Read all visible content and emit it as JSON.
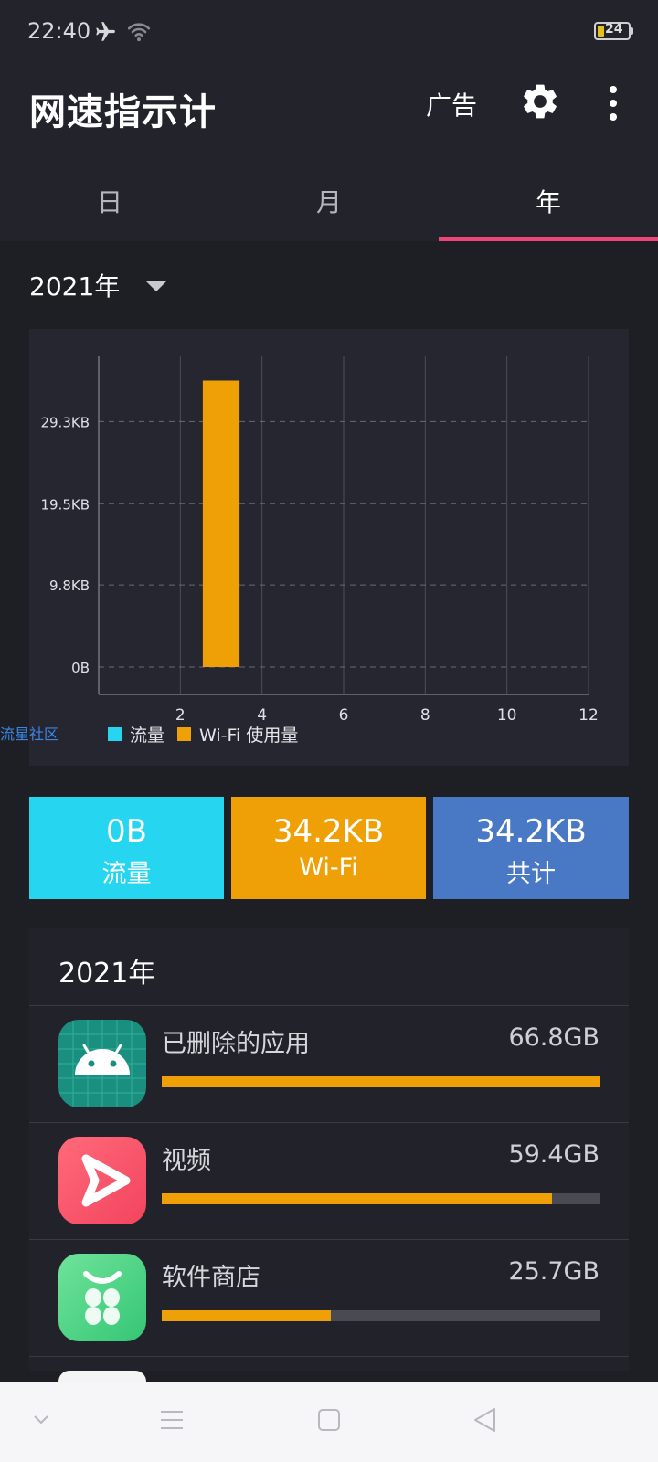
{
  "status": {
    "time": "22:40",
    "battery": "24"
  },
  "header": {
    "title": "网速指示计",
    "ad_label": "广告"
  },
  "tabs": [
    "日",
    "月",
    "年"
  ],
  "year_selector": {
    "value": "2021年"
  },
  "chart_data": {
    "type": "bar",
    "x": [
      3
    ],
    "values": [
      34.2
    ],
    "value_unit": "KB",
    "xlim": [
      0,
      12
    ],
    "xticks": [
      2,
      4,
      6,
      8,
      10,
      12
    ],
    "ylim": [
      0,
      36
    ],
    "yticks": [
      0,
      9.8,
      19.5,
      29.3
    ],
    "ytick_labels": [
      "0B",
      "9.8KB",
      "19.5KB",
      "29.3KB"
    ],
    "series": [
      {
        "name": "流量",
        "color": "#26d5f0",
        "values": [
          0
        ]
      },
      {
        "name": "Wi-Fi  使用量",
        "color": "#f0a007",
        "values": [
          34.2
        ]
      }
    ],
    "grid": true,
    "legend": "bottom-left"
  },
  "watermark": "流星社区",
  "summary": [
    {
      "value": "0B",
      "label": "流量",
      "color": "#26d5f0"
    },
    {
      "value": "34.2KB",
      "label": "Wi-Fi",
      "color": "#f0a007"
    },
    {
      "value": "34.2KB",
      "label": "共计",
      "color": "#4978c4"
    }
  ],
  "list": {
    "title": "2021年",
    "items": [
      {
        "name": "已删除的应用",
        "size": "66.8GB",
        "fraction": 1.0,
        "icon": "android-icon"
      },
      {
        "name": "视频",
        "size": "59.4GB",
        "fraction": 0.889,
        "icon": "video-play-icon"
      },
      {
        "name": "软件商店",
        "size": "25.7GB",
        "fraction": 0.385,
        "icon": "app-store-icon"
      }
    ]
  }
}
